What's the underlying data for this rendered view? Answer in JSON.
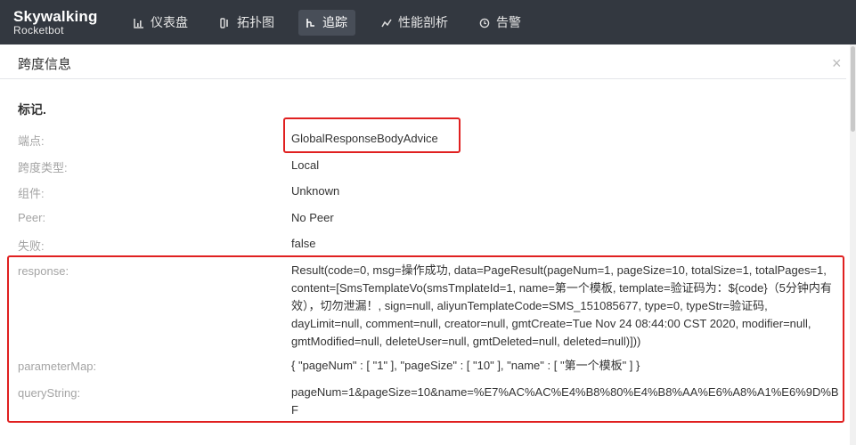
{
  "brand": {
    "name": "Skywalking",
    "subtitle": "Rocketbot"
  },
  "nav": [
    {
      "label": "仪表盘",
      "icon": "dashboard-icon",
      "active": false
    },
    {
      "label": "拓扑图",
      "icon": "topology-icon",
      "active": false
    },
    {
      "label": "追踪",
      "icon": "trace-icon",
      "active": true
    },
    {
      "label": "性能剖析",
      "icon": "profile-icon",
      "active": false
    },
    {
      "label": "告警",
      "icon": "alarm-icon",
      "active": false
    }
  ],
  "panel": {
    "title": "跨度信息",
    "close_glyph": "×"
  },
  "tags": {
    "title": "标记.",
    "rows": [
      {
        "label": "端点:",
        "value": "GlobalResponseBodyAdvice"
      },
      {
        "label": "跨度类型:",
        "value": "Local"
      },
      {
        "label": "组件:",
        "value": "Unknown"
      },
      {
        "label": "Peer:",
        "value": "No Peer"
      },
      {
        "label": "失败:",
        "value": "false"
      },
      {
        "label": "response:",
        "value": "Result(code=0, msg=操作成功, data=PageResult(pageNum=1, pageSize=10, totalSize=1, totalPages=1, content=[SmsTemplateVo(smsTmplateId=1, name=第一个模板, template=验证码为：${code}（5分钟内有效），切勿泄漏！, sign=null, aliyunTemplateCode=SMS_151085677, type=0, typeStr=验证码, dayLimit=null, comment=null, creator=null, gmtCreate=Tue Nov 24 08:44:00 CST 2020, modifier=null, gmtModified=null, deleteUser=null, gmtDeleted=null, deleted=null)]))"
      },
      {
        "label": "parameterMap:",
        "value": "{ \"pageNum\" : [ \"1\" ], \"pageSize\" : [ \"10\" ], \"name\" : [ \"第一个模板\" ] }"
      },
      {
        "label": "queryString:",
        "value": "pageNum=1&pageSize=10&name=%E7%AC%AC%E4%B8%80%E4%B8%AA%E6%A8%A1%E6%9D%BF"
      }
    ]
  },
  "colors": {
    "topbar": "#333840",
    "highlight_box": "#e02020",
    "label": "#a4a4a4"
  }
}
